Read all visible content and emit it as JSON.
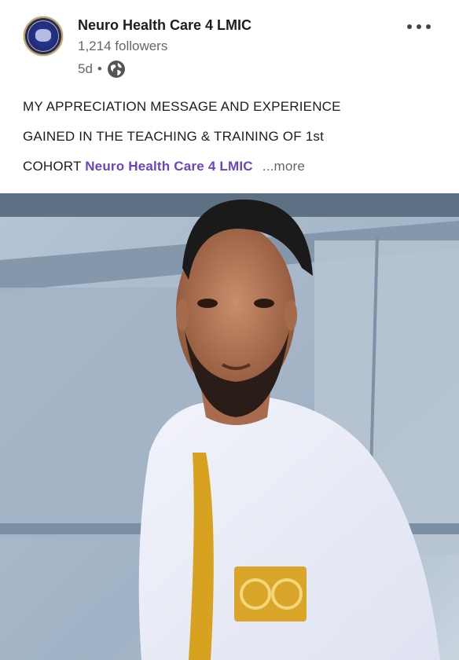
{
  "post": {
    "author": {
      "name": "Neuro Health Care 4 LMIC",
      "followers": "1,214 followers",
      "age": "5d",
      "separator": "•",
      "visibility_icon": "globe-icon"
    },
    "menu_icon": "more-options-icon",
    "text_lines": [
      "MY APPRECIATION MESSAGE AND EXPERIENCE",
      "GAINED IN THE TEACHING & TRAINING OF 1st",
      "COHORT"
    ],
    "mention": "Neuro Health Care 4 LMIC",
    "see_more": "...more",
    "image": {
      "description_icon": "post-photo",
      "colors": {
        "background_car": "#9fb2c6",
        "garment": "#e9ecf6",
        "embroidery": "#d6a21f"
      }
    }
  }
}
